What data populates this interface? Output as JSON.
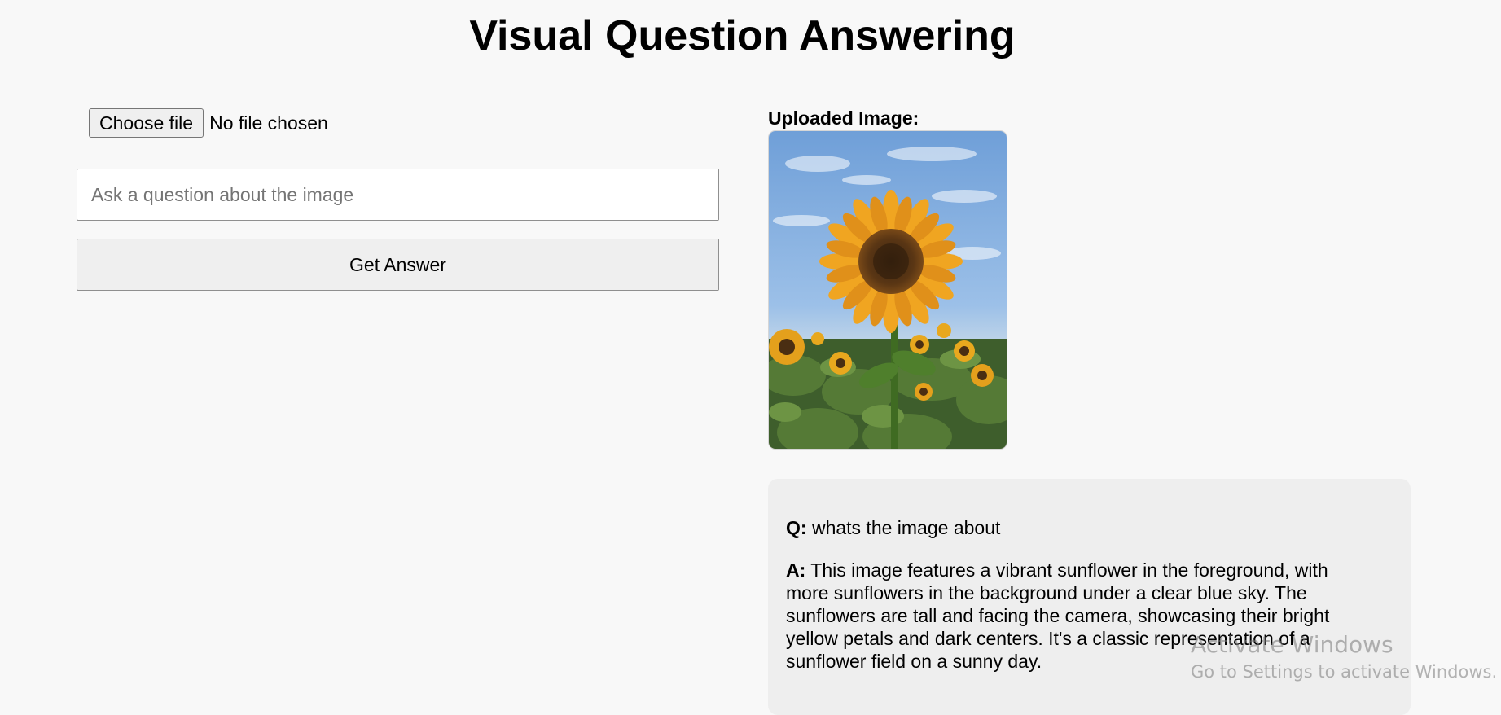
{
  "page": {
    "title": "Visual Question Answering"
  },
  "upload": {
    "button_label": "Choose file",
    "status_text": "No file chosen"
  },
  "question_input": {
    "placeholder": "Ask a question about the image",
    "value": ""
  },
  "submit": {
    "label": "Get Answer"
  },
  "preview": {
    "label": "Uploaded Image:",
    "image_description_icon": "sunflower-photo"
  },
  "qa": {
    "question_prefix": "Q:",
    "question": "whats the image about",
    "answer_prefix": "A:",
    "answer": "This image features a vibrant sunflower in the foreground, with more sunflowers in the background under a clear blue sky. The sunflowers are tall and facing the camera, showcasing their bright yellow petals and dark centers. It's a classic representation of a sunflower field on a sunny day."
  },
  "watermark": {
    "title": "Activate Windows",
    "subtitle": "Go to Settings to activate Windows."
  },
  "colors": {
    "background": "#f8f8f8",
    "card": "#eeeeee",
    "button": "#efefef"
  }
}
